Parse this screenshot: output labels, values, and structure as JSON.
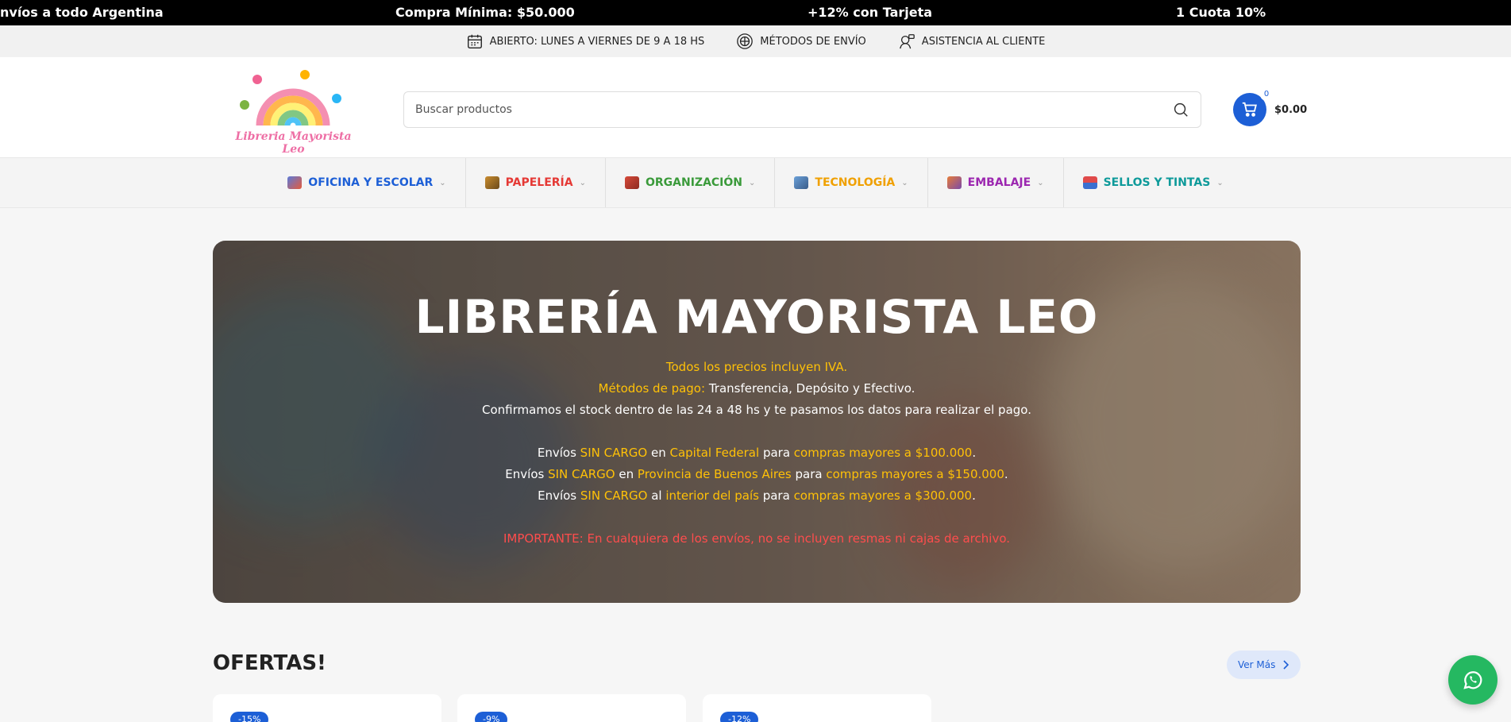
{
  "ticker": [
    "nvíos a todo Argentina",
    "Compra Mínima: $50.000",
    "+12% con Tarjeta",
    "1 Cuota 10%"
  ],
  "infobar": {
    "hours": "ABIERTO: LUNES A VIERNES DE 9 A 18 HS",
    "shipping": "MÉTODOS DE ENVÍO",
    "support": "ASISTENCIA AL CLIENTE"
  },
  "header": {
    "logo_text": "Libreria Mayorista Leo",
    "search_placeholder": "Buscar productos",
    "cart_count": "0",
    "cart_total": "$0.00"
  },
  "nav": [
    {
      "label": "OFICINA Y ESCOLAR",
      "color": "#1d5fd6"
    },
    {
      "label": "PAPELERÍA",
      "color": "#e53935"
    },
    {
      "label": "ORGANIZACIÓN",
      "color": "#3a9a3a"
    },
    {
      "label": "TECNOLOGÍA",
      "color": "#f0a000"
    },
    {
      "label": "EMBALAJE",
      "color": "#9c27b0"
    },
    {
      "label": "SELLOS Y TINTAS",
      "color": "#0e9a9a"
    }
  ],
  "hero": {
    "title": "LIBRERÍA MAYORISTA LEO",
    "iva": "Todos los precios incluyen IVA.",
    "pago_label": "Métodos de pago:",
    "pago_value": " Transferencia, Depósito y Efectivo.",
    "stock": "Confirmamos el stock dentro de las 24 a 48 hs y te pasamos los datos para realizar el pago.",
    "envio_word": "Envíos ",
    "sin_cargo": "SIN CARGO",
    "en": " en ",
    "al": " al ",
    "para": " para ",
    "caba": "Capital Federal",
    "caba_min": "compras mayores a $100.000",
    "pba": "Provincia de Buenos Aires",
    "pba_min": "compras mayores a $150.000",
    "interior": "interior del país",
    "interior_min": "compras mayores a $300.000",
    "dot": ".",
    "importante": "IMPORTANTE: En cualquiera de los envíos, no se incluyen resmas ni cajas de archivo."
  },
  "offers": {
    "title": "OFERTAS!",
    "ver_mas": "Ver Más",
    "badges": [
      "-15%",
      "-9%",
      "-12%"
    ]
  }
}
